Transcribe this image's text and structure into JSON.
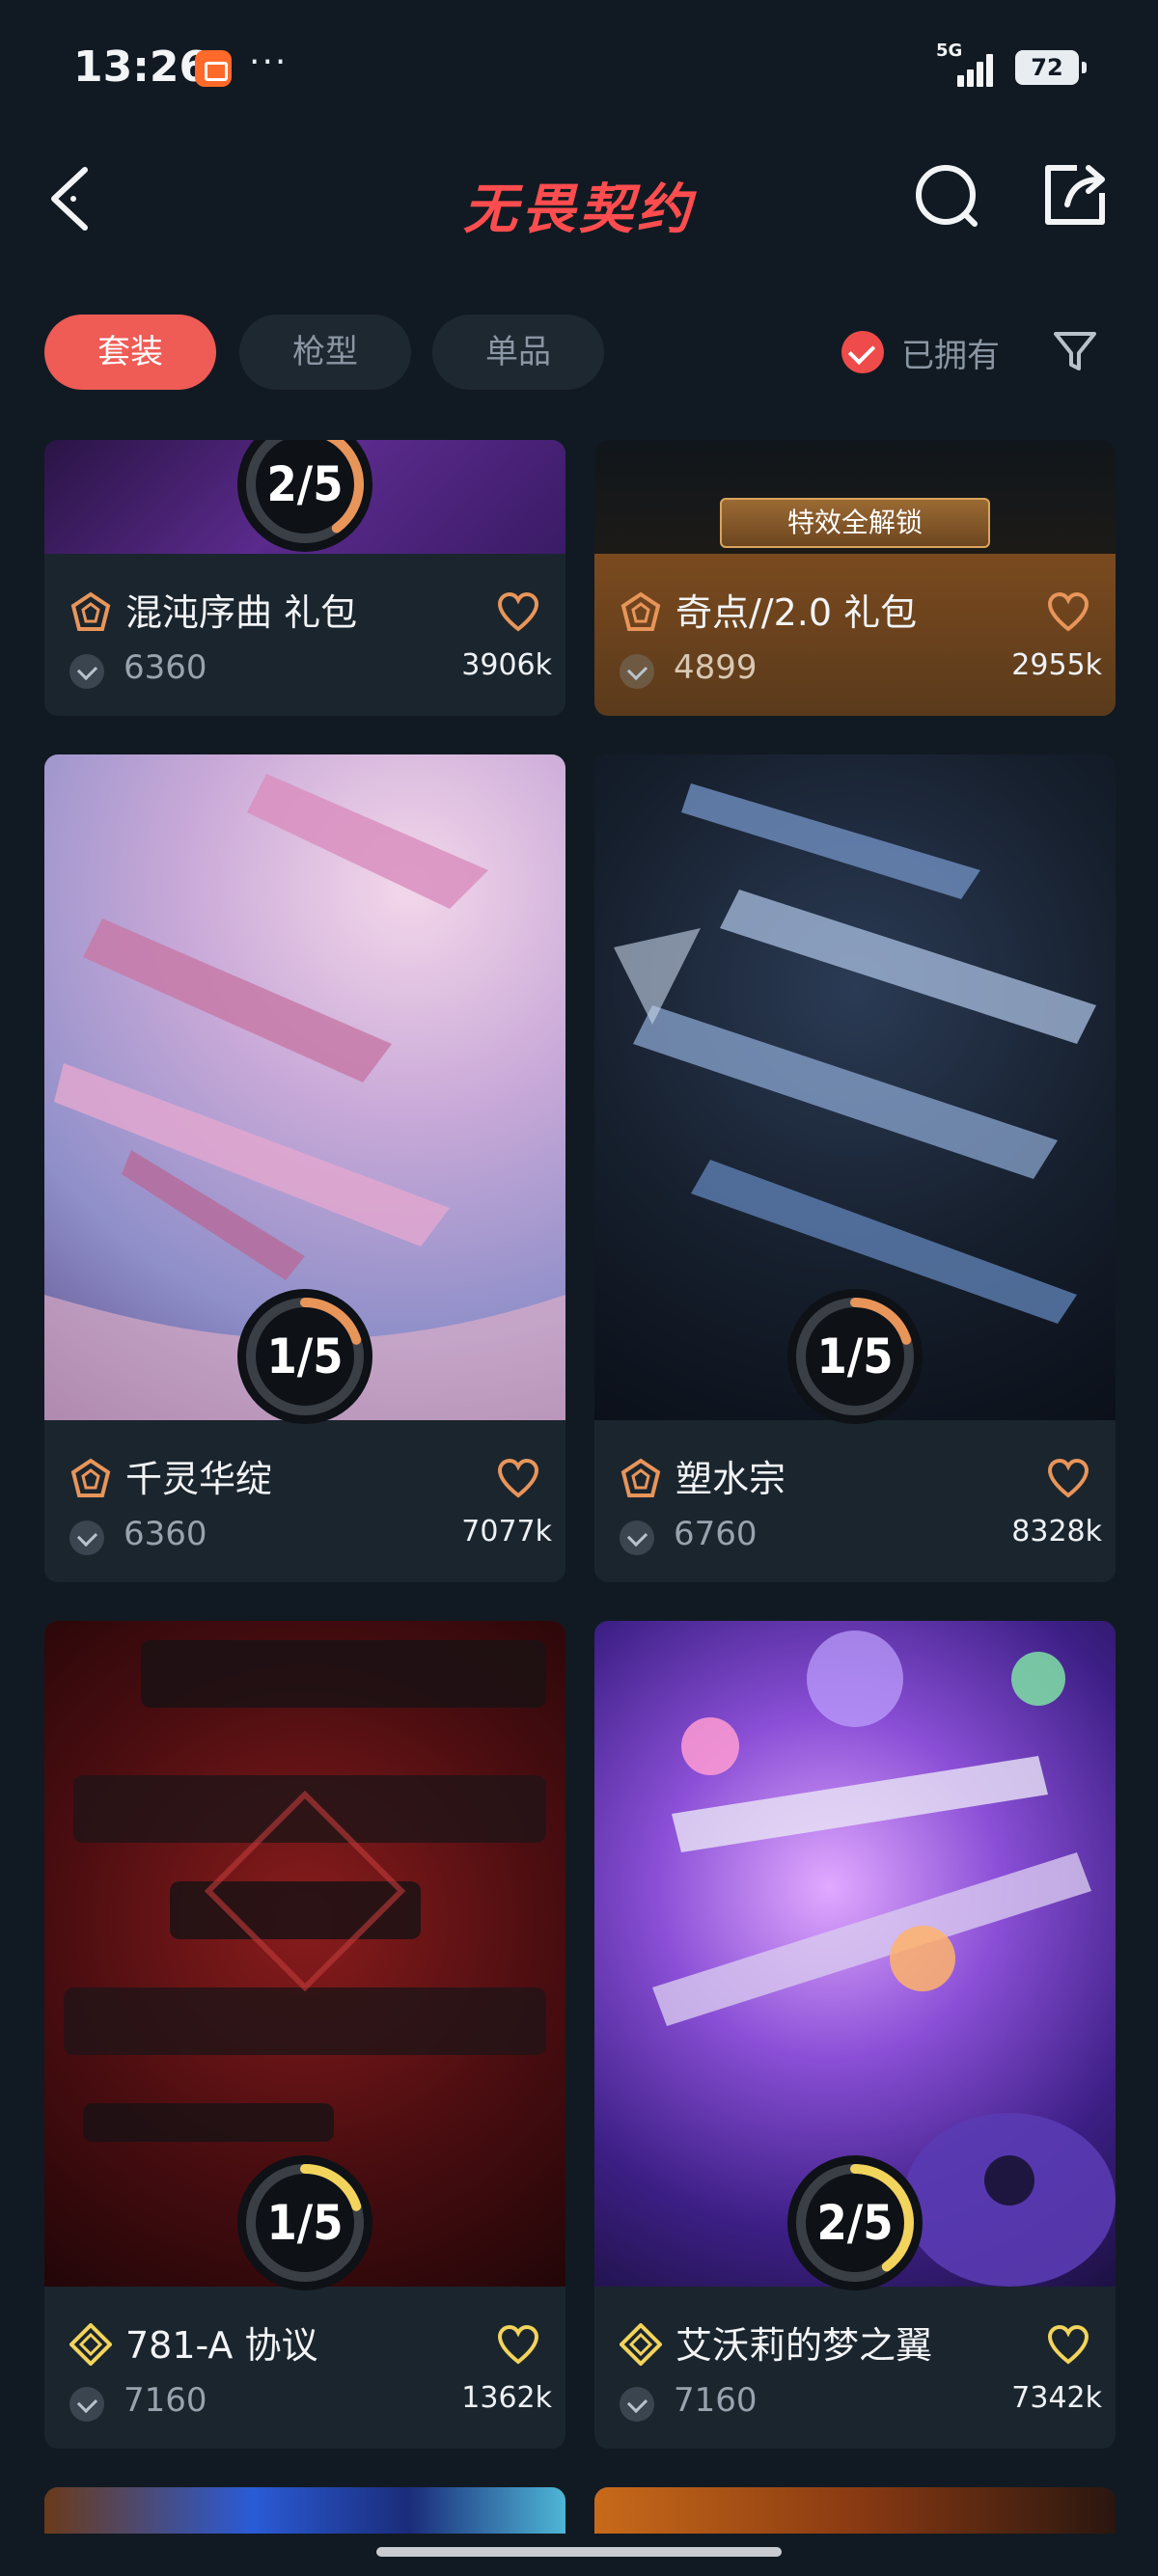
{
  "status_bar": {
    "time": "13:26",
    "network": "5G",
    "battery": "72"
  },
  "header": {
    "title": "无畏契约"
  },
  "filters": {
    "tabs": [
      {
        "label": "套装",
        "active": true
      },
      {
        "label": "枪型",
        "active": false
      },
      {
        "label": "单品",
        "active": false
      }
    ],
    "owned_label": "已拥有",
    "owned_checked": true
  },
  "cards": [
    {
      "name": "混沌序曲 礼包",
      "price": "6360",
      "likes": "3906k",
      "progress": "2/5",
      "owned": 2,
      "total": 5,
      "tier": "premium"
    },
    {
      "name": "奇点//2.0 礼包",
      "price": "4899",
      "likes": "2955k",
      "badge": "特效全解锁",
      "tier": "premium"
    },
    {
      "name": "千灵华绽",
      "price": "6360",
      "likes": "7077k",
      "progress": "1/5",
      "owned": 1,
      "total": 5,
      "tier": "premium"
    },
    {
      "name": "塑水宗",
      "price": "6760",
      "likes": "8328k",
      "progress": "1/5",
      "owned": 1,
      "total": 5,
      "tier": "premium"
    },
    {
      "name": "781-A 协议",
      "price": "7160",
      "likes": "1362k",
      "progress": "1/5",
      "owned": 1,
      "total": 5,
      "tier": "exclusive"
    },
    {
      "name": "艾沃莉的梦之翼",
      "price": "7160",
      "likes": "7342k",
      "progress": "2/5",
      "owned": 2,
      "total": 5,
      "tier": "exclusive"
    }
  ],
  "colors": {
    "accent": "#ef5b55",
    "background": "#111a22",
    "card": "#1b252e",
    "progress_premium": "#e8955a",
    "progress_exclusive": "#f2d45c"
  }
}
